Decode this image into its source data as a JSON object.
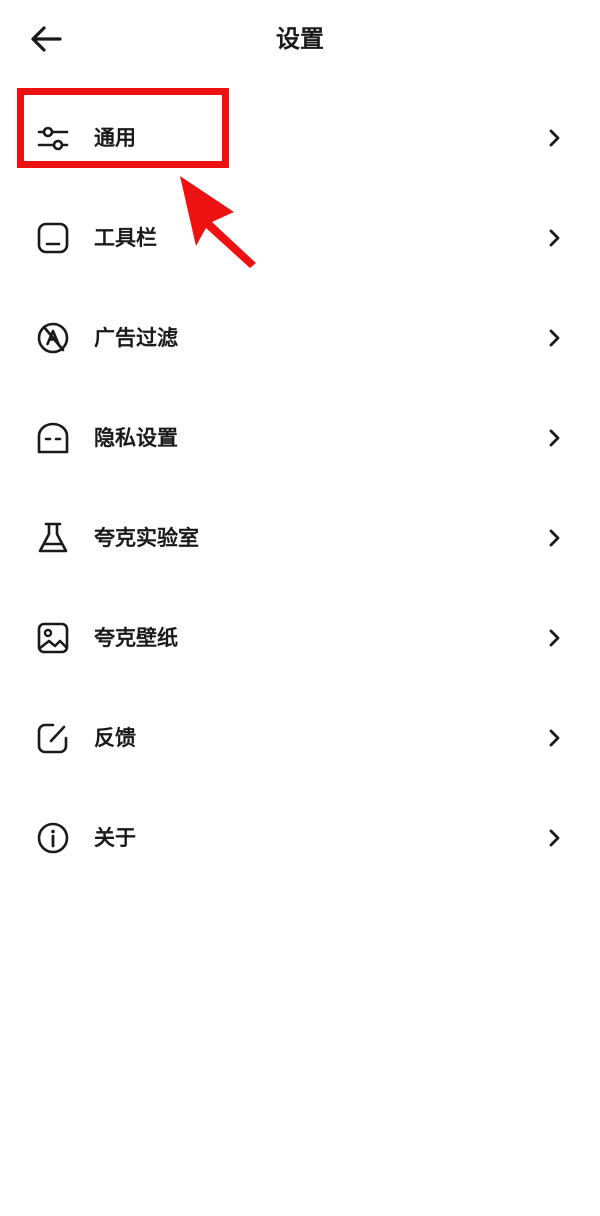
{
  "header": {
    "title": "设置",
    "back_icon": "arrow-left-icon"
  },
  "menu": {
    "items": [
      {
        "label": "通用",
        "icon": "sliders-icon"
      },
      {
        "label": "工具栏",
        "icon": "toolbar-icon"
      },
      {
        "label": "广告过滤",
        "icon": "ad-block-icon"
      },
      {
        "label": "隐私设置",
        "icon": "privacy-face-icon"
      },
      {
        "label": "夸克实验室",
        "icon": "flask-icon"
      },
      {
        "label": "夸克壁纸",
        "icon": "image-icon"
      },
      {
        "label": "反馈",
        "icon": "edit-icon"
      },
      {
        "label": "关于",
        "icon": "info-icon"
      }
    ]
  },
  "annotation": {
    "color": "#ee1111"
  }
}
